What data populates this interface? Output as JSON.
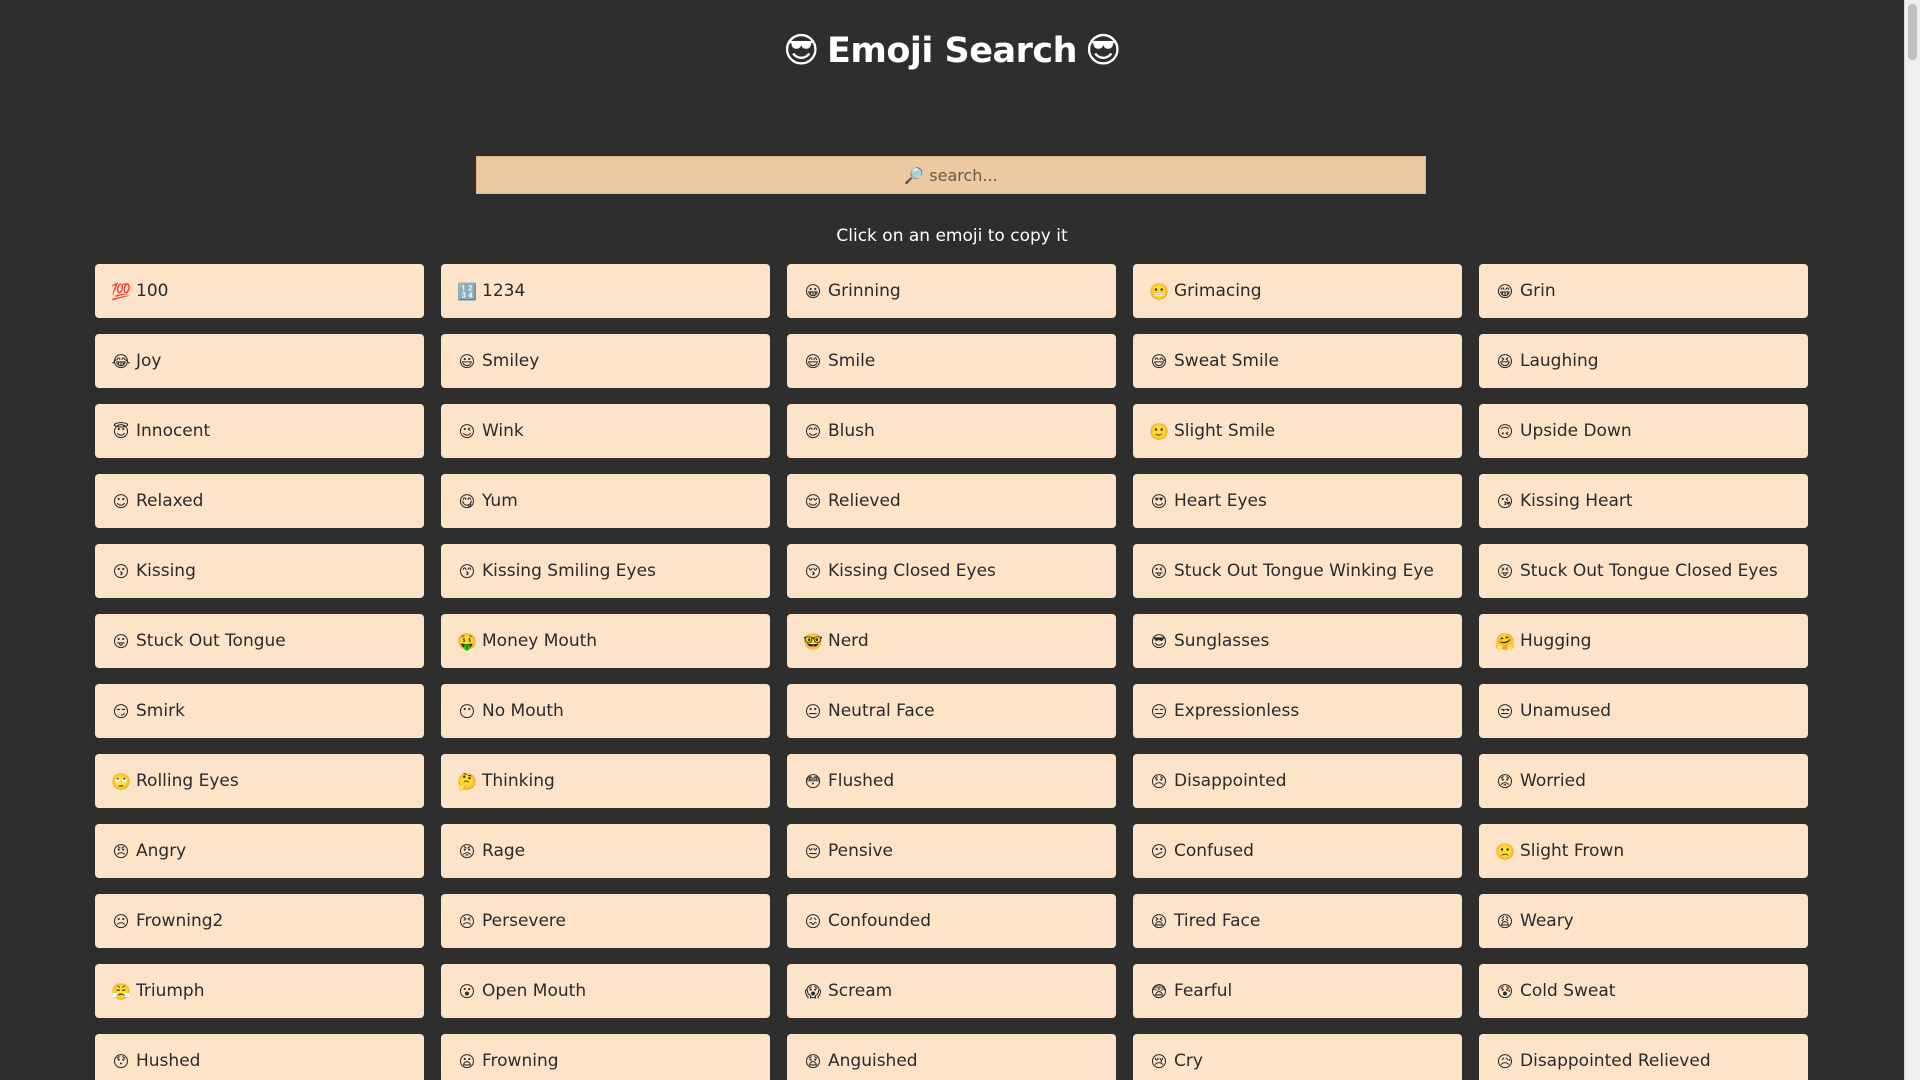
{
  "header": {
    "emoji_left": "😎",
    "title": "Emoji Search",
    "emoji_right": "😎"
  },
  "search": {
    "placeholder": "🔎 search...",
    "value": ""
  },
  "hint": "Click on an emoji to copy it",
  "emojis": [
    {
      "icon": "💯",
      "label": "100"
    },
    {
      "icon": "🔢",
      "label": "1234"
    },
    {
      "icon": "😀",
      "label": "Grinning"
    },
    {
      "icon": "😬",
      "label": "Grimacing"
    },
    {
      "icon": "😁",
      "label": "Grin"
    },
    {
      "icon": "😂",
      "label": "Joy"
    },
    {
      "icon": "😃",
      "label": "Smiley"
    },
    {
      "icon": "😄",
      "label": "Smile"
    },
    {
      "icon": "😅",
      "label": "Sweat Smile"
    },
    {
      "icon": "😆",
      "label": "Laughing"
    },
    {
      "icon": "😇",
      "label": "Innocent"
    },
    {
      "icon": "😉",
      "label": "Wink"
    },
    {
      "icon": "😊",
      "label": "Blush"
    },
    {
      "icon": "🙂",
      "label": "Slight Smile"
    },
    {
      "icon": "🙃",
      "label": "Upside Down"
    },
    {
      "icon": "☺",
      "label": "Relaxed"
    },
    {
      "icon": "😋",
      "label": "Yum"
    },
    {
      "icon": "😌",
      "label": "Relieved"
    },
    {
      "icon": "😍",
      "label": "Heart Eyes"
    },
    {
      "icon": "😘",
      "label": "Kissing Heart"
    },
    {
      "icon": "😗",
      "label": "Kissing"
    },
    {
      "icon": "😙",
      "label": "Kissing Smiling Eyes"
    },
    {
      "icon": "😚",
      "label": "Kissing Closed Eyes"
    },
    {
      "icon": "😜",
      "label": "Stuck Out Tongue Winking Eye"
    },
    {
      "icon": "😝",
      "label": "Stuck Out Tongue Closed Eyes"
    },
    {
      "icon": "😛",
      "label": "Stuck Out Tongue"
    },
    {
      "icon": "🤑",
      "label": "Money Mouth"
    },
    {
      "icon": "🤓",
      "label": "Nerd"
    },
    {
      "icon": "😎",
      "label": "Sunglasses"
    },
    {
      "icon": "🤗",
      "label": "Hugging"
    },
    {
      "icon": "😏",
      "label": "Smirk"
    },
    {
      "icon": "😶",
      "label": "No Mouth"
    },
    {
      "icon": "😐",
      "label": "Neutral Face"
    },
    {
      "icon": "😑",
      "label": "Expressionless"
    },
    {
      "icon": "😒",
      "label": "Unamused"
    },
    {
      "icon": "🙄",
      "label": "Rolling Eyes"
    },
    {
      "icon": "🤔",
      "label": "Thinking"
    },
    {
      "icon": "😳",
      "label": "Flushed"
    },
    {
      "icon": "😞",
      "label": "Disappointed"
    },
    {
      "icon": "😟",
      "label": "Worried"
    },
    {
      "icon": "😠",
      "label": "Angry"
    },
    {
      "icon": "😡",
      "label": "Rage"
    },
    {
      "icon": "😔",
      "label": "Pensive"
    },
    {
      "icon": "😕",
      "label": "Confused"
    },
    {
      "icon": "🙁",
      "label": "Slight Frown"
    },
    {
      "icon": "☹",
      "label": "Frowning2"
    },
    {
      "icon": "😣",
      "label": "Persevere"
    },
    {
      "icon": "😖",
      "label": "Confounded"
    },
    {
      "icon": "😫",
      "label": "Tired Face"
    },
    {
      "icon": "😩",
      "label": "Weary"
    },
    {
      "icon": "😤",
      "label": "Triumph"
    },
    {
      "icon": "😮",
      "label": "Open Mouth"
    },
    {
      "icon": "😱",
      "label": "Scream"
    },
    {
      "icon": "😨",
      "label": "Fearful"
    },
    {
      "icon": "😰",
      "label": "Cold Sweat"
    },
    {
      "icon": "😯",
      "label": "Hushed"
    },
    {
      "icon": "😦",
      "label": "Frowning"
    },
    {
      "icon": "😧",
      "label": "Anguished"
    },
    {
      "icon": "😢",
      "label": "Cry"
    },
    {
      "icon": "😥",
      "label": "Disappointed Relieved"
    }
  ]
}
